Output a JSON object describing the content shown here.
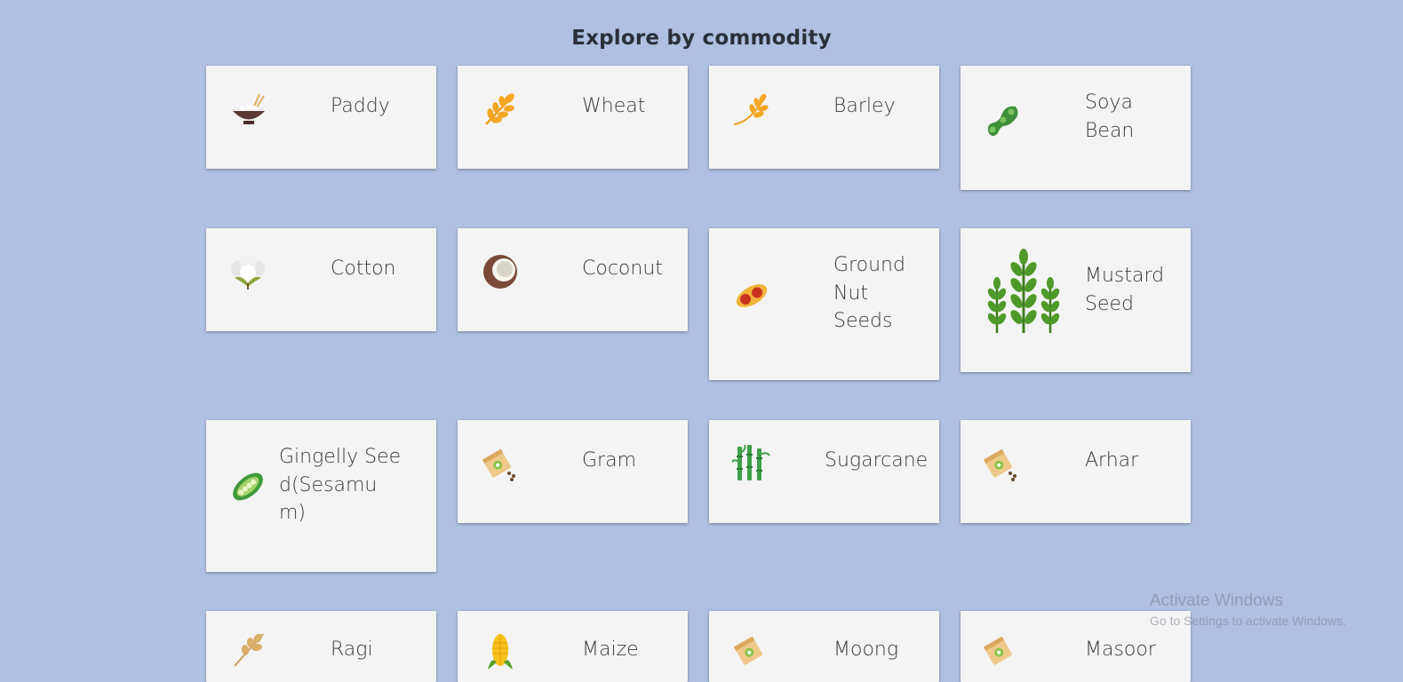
{
  "heading": "Explore by commodity",
  "commodities": [
    {
      "label": "Paddy",
      "icon": "rice-bowl-icon"
    },
    {
      "label": "Wheat",
      "icon": "wheat-icon"
    },
    {
      "label": "Barley",
      "icon": "barley-icon"
    },
    {
      "label": "Soya Bean",
      "icon": "soybean-icon"
    },
    {
      "label": "Cotton",
      "icon": "cotton-icon"
    },
    {
      "label": "Coconut",
      "icon": "coconut-icon"
    },
    {
      "label": "Ground Nut Seeds",
      "icon": "peanut-icon"
    },
    {
      "label": "Mustard Seed",
      "icon": "mustard-plant-icon"
    },
    {
      "label": "Gingelly Seed(Sesamum)",
      "icon": "sesame-pod-icon"
    },
    {
      "label": "Gram",
      "icon": "seed-packet-icon"
    },
    {
      "label": "Sugarcane",
      "icon": "sugarcane-icon"
    },
    {
      "label": "Arhar",
      "icon": "seed-packet-icon"
    },
    {
      "label": "Ragi",
      "icon": "ragi-icon"
    },
    {
      "label": "Maize",
      "icon": "maize-icon"
    },
    {
      "label": "Moong",
      "icon": "seed-packet-icon"
    },
    {
      "label": "Masoor",
      "icon": "seed-packet-icon"
    }
  ],
  "watermark": {
    "line1": "Activate Windows",
    "line2": "Go to Settings to activate Windows."
  }
}
